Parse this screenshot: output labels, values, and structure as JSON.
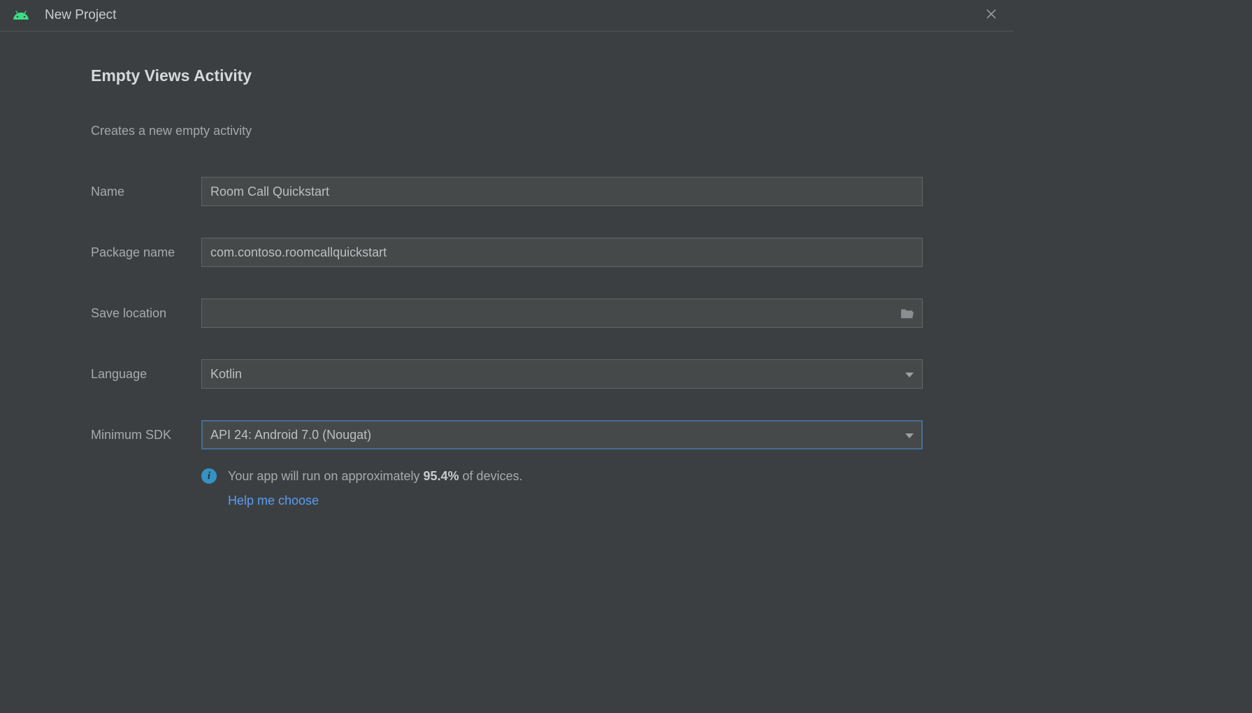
{
  "titlebar": {
    "title": "New Project"
  },
  "form": {
    "heading": "Empty Views Activity",
    "description": "Creates a new empty activity",
    "name_label": "Name",
    "name_value": "Room Call Quickstart",
    "package_label": "Package name",
    "package_value": "com.contoso.roomcallquickstart",
    "save_label": "Save location",
    "save_value": "",
    "language_label": "Language",
    "language_value": "Kotlin",
    "sdk_label": "Minimum SDK",
    "sdk_value": "API 24: Android 7.0 (Nougat)"
  },
  "info": {
    "prefix": "Your app will run on approximately ",
    "percent": "95.4%",
    "suffix": " of devices.",
    "help_link": "Help me choose"
  }
}
